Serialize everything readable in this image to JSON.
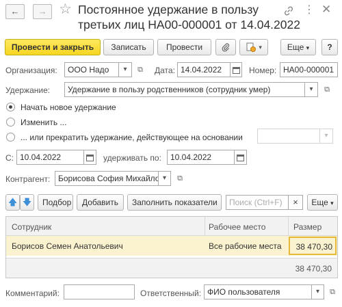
{
  "window": {
    "title_line1": "Постоянное удержание в пользу",
    "title_line2": "третьих лиц НА00-000001 от 14.04.2022"
  },
  "toolbar": {
    "post_close": "Провести и закрыть",
    "save": "Записать",
    "post": "Провести",
    "more": "Еще"
  },
  "header": {
    "org_label": "Организация:",
    "org_value": "ООО Надо",
    "date_label": "Дата:",
    "date_value": "14.04.2022",
    "number_label": "Номер:",
    "number_value": "НА00-000001",
    "deduction_label": "Удержание:",
    "deduction_value": "Удержание в пользу родственников (сотрудник умер)"
  },
  "mode": {
    "option_new": "Начать новое удержание",
    "option_change": "Изменить ...",
    "option_stop": "... или прекратить удержание, действующее на основании",
    "basis_value": ""
  },
  "period": {
    "from_label": "С:",
    "from_value": "10.04.2022",
    "to_label": "удерживать по:",
    "to_value": "10.04.2022"
  },
  "contractor": {
    "label": "Контрагент:",
    "value": "Борисова София Михайловна"
  },
  "table_toolbar": {
    "select": "Подбор",
    "add": "Добавить",
    "fill": "Заполнить показатели",
    "search_placeholder": "Поиск (Ctrl+F)",
    "clear": "×",
    "more": "Еще"
  },
  "table": {
    "columns": [
      "Сотрудник",
      "Рабочее место",
      "Размер"
    ],
    "rows": [
      {
        "employee": "Борисов Семен Анатольевич",
        "workplace": "Все рабочие места",
        "amount": "38 470,30"
      }
    ],
    "total": "38 470,30"
  },
  "footer": {
    "comment_label": "Комментарий:",
    "comment_value": "",
    "responsible_label": "Ответственный:",
    "responsible_value": "ФИО пользователя"
  },
  "colors": {
    "primary_button": "#f6d521",
    "selected_row": "#fbf3cf",
    "selected_cell_border": "#e5b93a"
  },
  "icons": [
    "back-arrow-icon",
    "forward-arrow-icon",
    "star-icon",
    "link-icon",
    "kebab-menu-icon",
    "close-icon",
    "paperclip-icon",
    "document-status-icon",
    "calendar-icon",
    "open-form-icon",
    "move-up-icon",
    "move-down-icon"
  ]
}
